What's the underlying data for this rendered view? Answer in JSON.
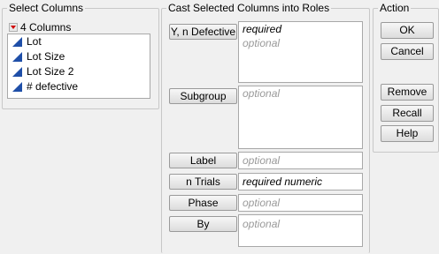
{
  "select_columns": {
    "title": "Select Columns",
    "count_label": "4 Columns",
    "columns": [
      {
        "name": "Lot",
        "icon": "continuous-icon"
      },
      {
        "name": "Lot Size",
        "icon": "continuous-icon"
      },
      {
        "name": "Lot Size 2",
        "icon": "continuous-icon"
      },
      {
        "name": "# defective",
        "icon": "continuous-icon"
      }
    ]
  },
  "cast_roles": {
    "title": "Cast Selected Columns into Roles",
    "roles": [
      {
        "button": "Y, n Defective",
        "lines": [
          "required",
          "optional"
        ]
      },
      {
        "button": "Subgroup",
        "lines": [
          "optional"
        ]
      },
      {
        "button": "Label",
        "lines": [
          "optional"
        ]
      },
      {
        "button": "n Trials",
        "lines": [
          "required numeric"
        ]
      },
      {
        "button": "Phase",
        "lines": [
          "optional"
        ]
      },
      {
        "button": "By",
        "lines": [
          "optional"
        ]
      }
    ]
  },
  "action": {
    "title": "Action",
    "buttons": [
      "OK",
      "Cancel",
      "Remove",
      "Recall",
      "Help"
    ]
  },
  "colors": {
    "icon_blue": "#1f4fa8",
    "dropdown_red": "#d00000"
  }
}
